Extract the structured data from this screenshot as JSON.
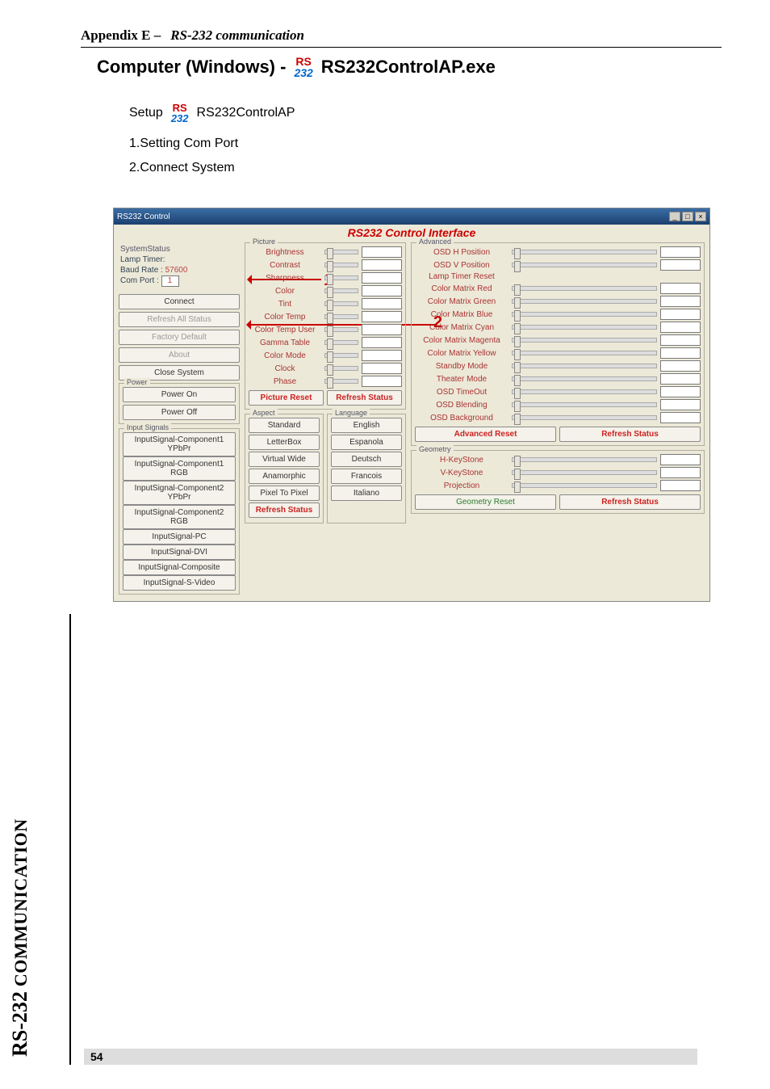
{
  "header": {
    "appendix": "Appendix E –",
    "subtitle": "RS-232 communication"
  },
  "title": {
    "left": "Computer (Windows) -",
    "right": "RS232ControlAP.exe"
  },
  "icon": {
    "top": "RS",
    "bot": "232"
  },
  "setup": {
    "label": "Setup",
    "app": "RS232ControlAP"
  },
  "steps": {
    "s1": "1.Setting Com Port",
    "s2": "2.Connect System"
  },
  "window": {
    "title": "RS232 Control",
    "min": "_",
    "max": "□",
    "close": "×",
    "iface": "RS232 Control Interface"
  },
  "callout": {
    "one": "1",
    "two": "2"
  },
  "system_status": {
    "title": "SystemStatus",
    "lamp": "Lamp Timer:",
    "baud": "Baud Rate  :",
    "baud_val": "57600",
    "com": "Com Port  :",
    "com_val": "1",
    "connect": "Connect",
    "refresh_all": "Refresh All Status",
    "factory": "Factory Default",
    "about": "About",
    "close": "Close System"
  },
  "power": {
    "title": "Power",
    "on": "Power On",
    "off": "Power Off"
  },
  "input": {
    "title": "Input Signals",
    "b1": "InputSignal-Component1 YPbPr",
    "b2": "InputSignal-Component1 RGB",
    "b3": "InputSignal-Component2 YPbPr",
    "b4": "InputSignal-Component2 RGB",
    "b5": "InputSignal-PC",
    "b6": "InputSignal-DVI",
    "b7": "InputSignal-Composite",
    "b8": "InputSignal-S-Video"
  },
  "picture": {
    "title": "Picture",
    "brightness": "Brightness",
    "contrast": "Contrast",
    "sharpness": "Sharpness",
    "color": "Color",
    "tint": "Tint",
    "ctemp": "Color Temp",
    "ctemp_user": "Color Temp User",
    "gamma": "Gamma Table",
    "cmode": "Color Mode",
    "clock": "Clock",
    "phase": "Phase",
    "preset": "Picture Reset",
    "refresh": "Refresh Status"
  },
  "aspect": {
    "title": "Aspect",
    "a1": "Standard",
    "a2": "LetterBox",
    "a3": "Virtual Wide",
    "a4": "Anamorphic",
    "a5": "Pixel To Pixel",
    "a6": "Refresh Status"
  },
  "language": {
    "title": "Language",
    "l1": "English",
    "l2": "Espanola",
    "l3": "Deutsch",
    "l4": "Francois",
    "l5": "Italiano"
  },
  "advanced": {
    "title": "Advanced",
    "osd_h": "OSD H Position",
    "osd_v": "OSD V Position",
    "lamp_reset": "Lamp Timer Reset",
    "cm_red": "Color Matrix Red",
    "cm_green": "Color Matrix Green",
    "cm_blue": "Color Matrix Blue",
    "cm_cyan": "Color Matrix Cyan",
    "cm_mag": "Color Matrix Magenta",
    "cm_yel": "Color Matrix Yellow",
    "standby": "Standby Mode",
    "theater": "Theater Mode",
    "timeout": "OSD TimeOut",
    "blend": "OSD Blending",
    "bg": "OSD Background",
    "areset": "Advanced Reset",
    "arefresh": "Refresh Status"
  },
  "geometry": {
    "title": "Geometry",
    "hk": "H-KeyStone",
    "vk": "V-KeyStone",
    "proj": "Projection",
    "greset": "Geometry Reset",
    "grefresh": "Refresh Status"
  },
  "side": {
    "big": "RS-232",
    "small": " COMMUNICATION"
  },
  "page": "54"
}
